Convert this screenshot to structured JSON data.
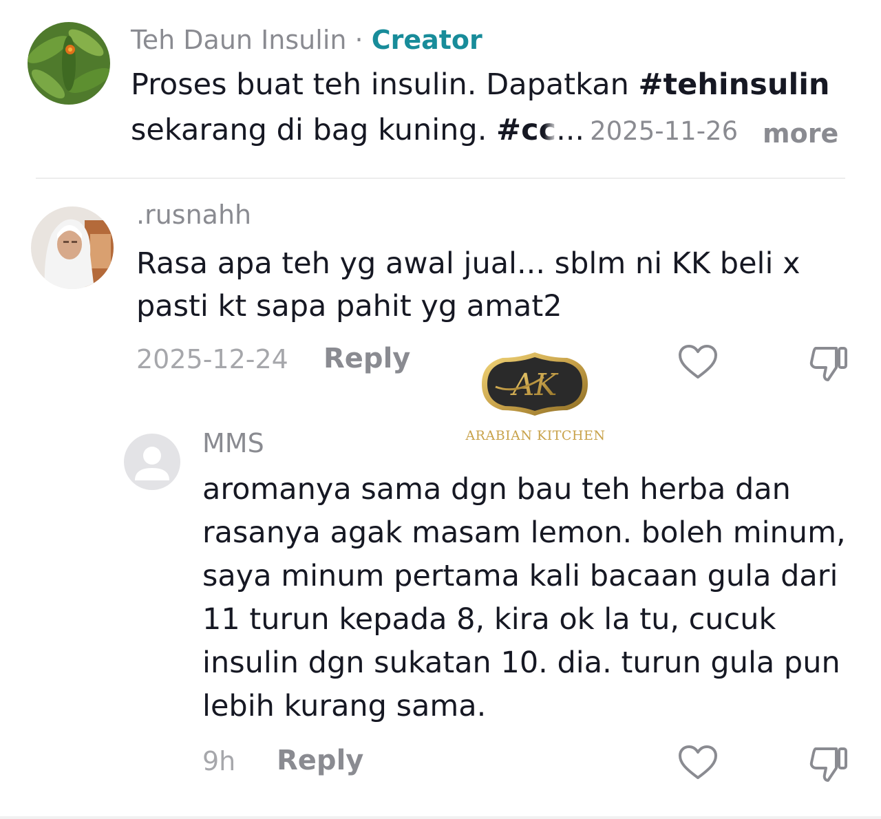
{
  "creator_post": {
    "username": "Teh Daun Insulin",
    "separator": " · ",
    "badge": "Creator",
    "caption_part1": "Proses buat teh insulin. Dapatkan ",
    "caption_hashtag1": "#tehinsulin",
    "caption_part2": "sekarang di bag kuning. ",
    "caption_hashtag2": "#c",
    "caption_hashtag2_faded": "c",
    "caption_ellipsis": "...",
    "date": "2025-11-26",
    "more_label": "more"
  },
  "comments": [
    {
      "username": ".rusnahh",
      "text": "Rasa apa teh yg awal jual... sblm ni KK beli x pasti kt sapa pahit yg amat2",
      "date": "2025-12-24",
      "reply_label": "Reply",
      "like_icon": "heart-outline-icon",
      "dislike_icon": "thumbs-down-icon"
    },
    {
      "username": "MMS",
      "text": "aromanya sama dgn bau teh herba dan rasanya agak masam lemon. boleh minum, saya minum pertama kali bacaan gula dari 11 turun kepada 8, kira ok la tu, cucuk insulin dgn sukatan 10. dia. turun gula pun lebih kurang sama.",
      "date": "9h",
      "reply_label": "Reply",
      "like_icon": "heart-outline-icon",
      "dislike_icon": "thumbs-down-icon"
    }
  ],
  "watermark": {
    "logo_letters": "AK",
    "text": "ARABIAN KITCHEN",
    "gold": "#c8a24a"
  },
  "colors": {
    "text_primary": "#161823",
    "text_secondary": "#8a8b91",
    "creator_badge": "#188c9a",
    "icon_gray": "#8a8b91"
  }
}
